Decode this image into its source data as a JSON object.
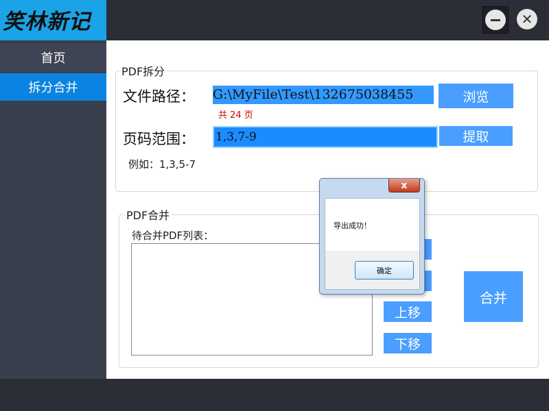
{
  "app": {
    "logo_text": "笑林新记"
  },
  "window_controls": {
    "minimize_icon": "minus-circle-icon",
    "close_icon": "close-circle-icon",
    "close_glyph": "✕"
  },
  "sidebar": {
    "items": [
      {
        "label": "首页",
        "active": false
      },
      {
        "label": "拆分合并",
        "active": true
      }
    ]
  },
  "split_section": {
    "title": "PDF拆分",
    "path_label": "文件路径：",
    "path_value": "G:\\MyFile\\Test\\132675038455",
    "browse_label": "浏览",
    "page_count": "共 24 页",
    "range_label": "页码范围：",
    "range_value": "1,3,7-9",
    "extract_label": "提取",
    "example": "例如：1,3,5-7"
  },
  "merge_section": {
    "title": "PDF合并",
    "list_label": "待合并PDF列表：",
    "move_up_label": "上移",
    "move_down_label": "下移",
    "merge_label": "合并"
  },
  "dialog": {
    "close_glyph": "x",
    "message": "导出成功！",
    "ok_label": "确定"
  },
  "colors": {
    "accent": "#0a84e0",
    "button": "#4a9eff",
    "logo_bg": "#1aa3e6",
    "sidebar": "#3a3f4d"
  }
}
